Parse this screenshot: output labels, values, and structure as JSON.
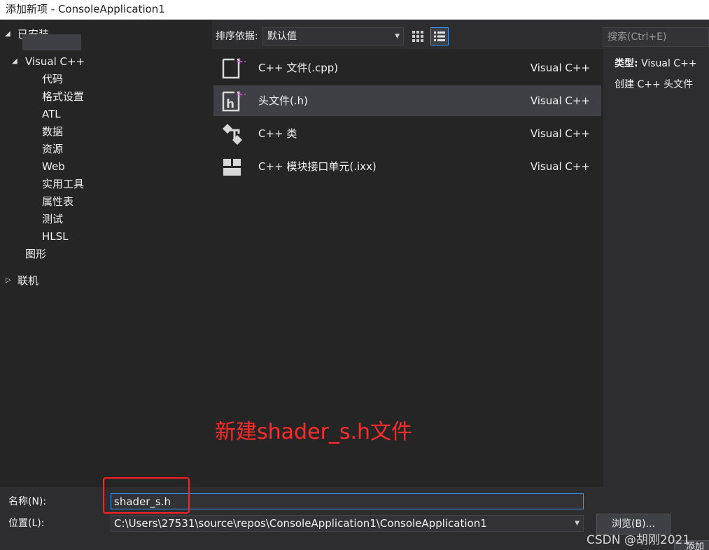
{
  "window": {
    "title": "添加新项 - ConsoleApplication1"
  },
  "tree": {
    "installed": "已安装",
    "visual_cpp": "Visual C++",
    "children": [
      "代码",
      "格式设置",
      "ATL",
      "数据",
      "资源",
      "Web",
      "实用工具",
      "属性表",
      "测试",
      "HLSL"
    ],
    "graphics": "图形",
    "online": "联机"
  },
  "toolbar": {
    "sort_label": "排序依据:",
    "sort_value": "默认值",
    "search_placeholder": "搜索(Ctrl+E)"
  },
  "templates": [
    {
      "name": "C++ 文件(.cpp)",
      "lang": "Visual C++",
      "icon": "cpp-file-icon"
    },
    {
      "name": "头文件(.h)",
      "lang": "Visual C++",
      "icon": "header-file-icon",
      "selected": true
    },
    {
      "name": "C++ 类",
      "lang": "Visual C++",
      "icon": "cpp-class-icon"
    },
    {
      "name": "C++ 模块接口单元(.ixx)",
      "lang": "Visual C++",
      "icon": "module-interface-icon"
    }
  ],
  "annotation": "新建shader_s.h文件",
  "details": {
    "type_label": "类型:",
    "type_value": "Visual C++",
    "description": "创建 C++ 头文件"
  },
  "form": {
    "name_label": "名称(N):",
    "name_value": "shader_s.h",
    "location_label": "位置(L):",
    "location_value": "C:\\Users\\27531\\source\\repos\\ConsoleApplication1\\ConsoleApplication1",
    "browse_label": "浏览(B)...",
    "add_label": "添加"
  },
  "watermark": "CSDN @胡刚2021",
  "colors": {
    "accent": "#3399ff",
    "icon_plus": "#c060c0",
    "annotation": "#ff2a2a"
  }
}
